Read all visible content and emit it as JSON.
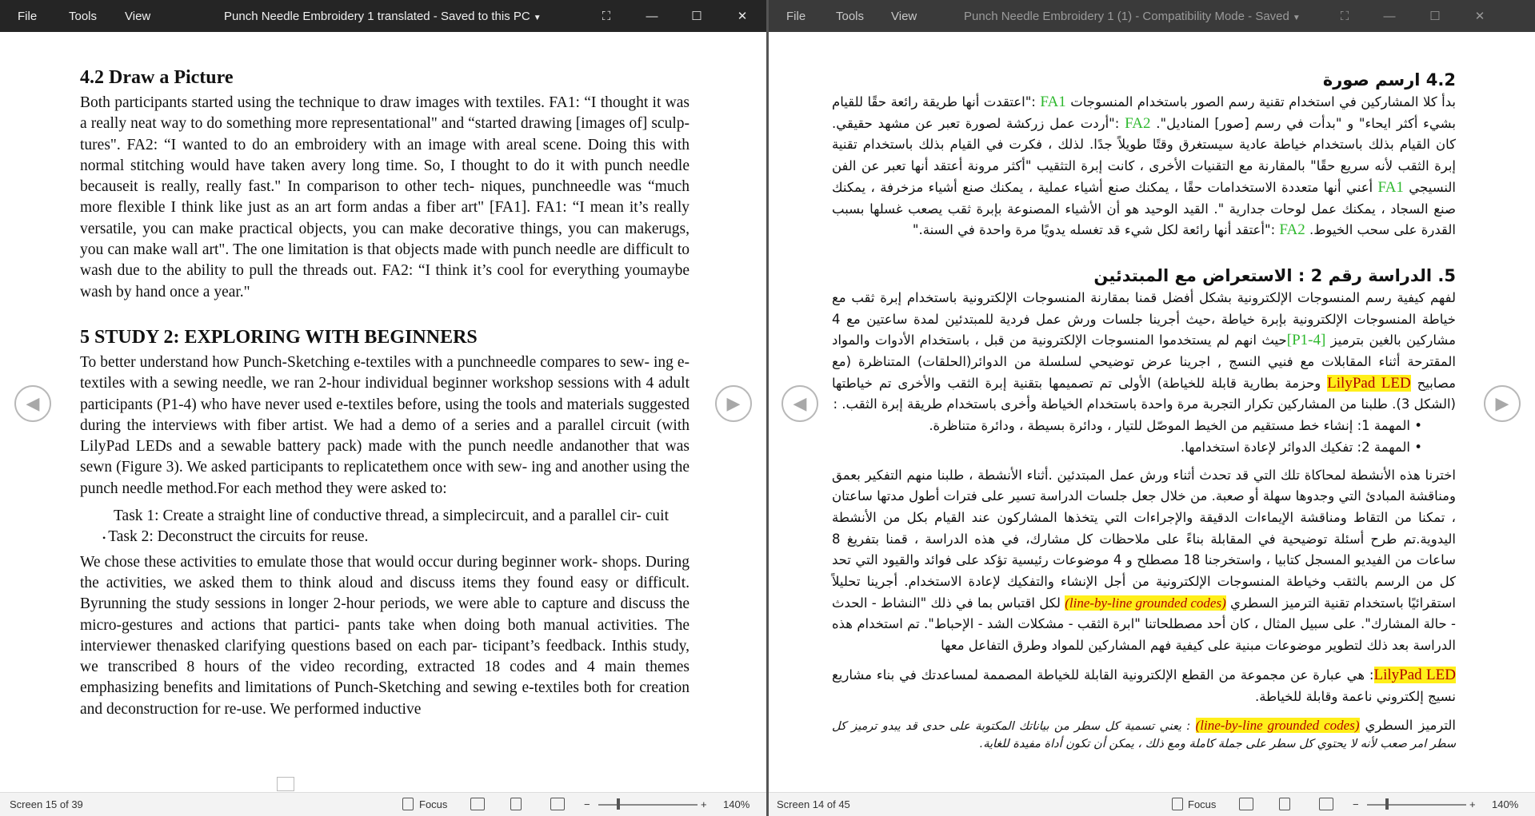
{
  "left": {
    "menu": {
      "file": "File",
      "tools": "Tools",
      "view": "View"
    },
    "title": "Punch Needle Embroidery 1 translated  -  Saved to this PC",
    "section42": "4.2 Draw a Picture",
    "p1": "Both participants started using the technique to draw images with textiles. FA1: “I thought it was a really neat way to do something more representational\" and “started drawing [images of] sculp- tures\". FA2: “I wanted to do an embroidery with an image with areal scene. Doing this with normal stitching would have taken avery long time. So, I thought to do it with punch needle becauseit is really, really fast.\" In comparison to other tech- niques, punchneedle was “much more flexible I think like just as an art form andas a fiber art\" [FA1]. FA1: “I mean it’s really versatile, you can make practical objects, you can make decorative things, you can makerugs, you can make wall art\". The one limitation is that objects made with punch needle are difficult to wash due to the ability to pull the threads out. FA2: “I think it’s cool for everything youmaybe wash by hand once a year.\"",
    "section5": "5 STUDY 2: EXPLORING WITH BEGINNERS",
    "p2": "To better understand how Punch-Sketching e-textiles with a punchneedle compares to sew- ing e-textiles with a sewing needle, we ran 2-hour individual beginner workshop sessions with 4 adult participants (P1-4) who have never used e-textiles before, using the tools and materials suggested during the interviews with fiber artist. We had a demo of a series and a parallel circuit (with LilyPad LEDs and a sewable battery pack) made with the punch needle andanother that was sewn (Figure 3). We asked participants to replicatethem once with sew- ing and another using the punch needle method.For each method they were asked to:",
    "task1": "Task 1: Create a straight line of conductive thread, a simplecircuit, and a parallel cir- cuit",
    "task2": "Task 2: Deconstruct the circuits for reuse.",
    "p3": "We chose these activities to emulate those that would occur during beginner work- shops. During the activities, we asked them to think aloud and discuss items they found easy or difficult. Byrunning the study sessions in longer 2-hour periods, we were able to capture and discuss the micro-gestures and actions that partici- pants take when doing both manual activities. The interviewer thenasked clarifying questions based on each par- ticipant’s feedback. Inthis study, we transcribed 8 hours of the video recording, extracted 18 codes and 4 main themes emphasizing benefits and limitations of Punch-Sketching and sewing e-textiles both for creation and deconstruction for re-use. We performed inductive",
    "status": {
      "screen": "Screen 15 of 39",
      "focus": "Focus",
      "zoom": "140%"
    }
  },
  "right": {
    "menu": {
      "file": "File",
      "tools": "Tools",
      "view": "View"
    },
    "title": "Punch Needle Embroidery 1 (1)  -  Compatibility Mode  -  Saved",
    "h42": "4.2  ارسم صورة",
    "p1a": "بدأ كلا المشاركين في استخدام تقنية رسم الصور باستخدام المنسوجات ",
    "fa1": "FA1",
    "p1b": " :\"اعتقدت أنها طريقة رائعة حقًا للقيام بشيء أكثر ايحاء\" و \"بدأت في رسم [صور] المناديل\". ",
    "fa2": "FA2",
    "p1c": " :\"أردت عمل زركشة لصورة تعبر عن مشهد حقيقي. كان القيام بذلك باستخدام خياطة عادية سيستغرق وقتًا طويلاً جدًا. لذلك ، فكرت في القيام بذلك باستخدام تقنية إبرة الثقب لأنه سريع حقًا\" بالمقارنة مع التقنيات الأخرى ، كانت إبرة التثقيب \"أكثر مرونة أعتقد أنها تعبر عن الفن النسيجي ",
    "p1d": " أعني أنها متعددة الاستخدامات حقًا ، يمكنك صنع أشياء عملية ، يمكنك صنع أشياء مزخرفة ، يمكنك صنع السجاد ، يمكنك عمل لوحات جدارية \". القيد الوحيد هو أن الأشياء المصنوعة بإبرة ثقب يصعب غسلها بسبب القدرة على سحب الخيوط. ",
    "p1e": " :\"أعتقد أنها رائعة لكل شيء قد تغسله يدويًا مرة واحدة في السنة.\"",
    "h5": "5. الدراسة رقم 2 : الاستعراض مع المبتدئين",
    "p2a": "لفهم كيفية رسم المنسوجات الإلكترونية بشكل أفضل قمنا بمقارنة المنسوجات الإلكترونية باستخدام إبرة ثقب مع خياطة المنسوجات الإلكترونية بإبرة خياطة ،حيث أجرينا جلسات ورش عمل فردية للمبتدئين لمدة ساعتين مع 4 مشاركين بالغين بترميز ",
    "p1_4": "[P1-4]",
    "p2b": "حيث انهم لم يستخدموا المنسوجات الإلكترونية من قبل ، باستخدام الأدوات والمواد المقترحة أثناء المقابلات مع فنيي النسج , اجرينا عرض توضيحي لسلسلة من الدوائر(الحلقات) المتناظرة (مع مصابيح ",
    "lilypad": "LilyPad LED",
    "p2c": " وحزمة بطارية قابلة للخياطة) الأولى تم تصميمها بتقنية إبرة الثقب والأخرى تم خياطتها (الشكل 3). طلبنا من المشاركين تكرار التجربة مرة واحدة باستخدام الخياطة وأخرى باستخدام طريقة إبرة الثقب. :",
    "task1": "المهمة 1: إنشاء خط مستقيم من الخيط الموصّل للتيار ، ودائرة بسيطة ، ودائرة متناظرة.",
    "task2": "المهمة 2: تفكيك الدوائر لإعادة استخدامها.",
    "p3a": "اخترنا هذه الأنشطة لمحاكاة تلك التي قد تحدث أثناء ورش عمل المبتدئين .أثناء الأنشطة ، طلبنا منهم التفكير بعمق ومناقشة المبادئ التي وجدوها سهلة أو صعبة. من خلال جعل جلسات الدراسة تسير على فترات أطول مدتها ساعتان ، تمكنا من التقاط ومناقشة الإيماءات الدقيقة والإجراءات التي يتخذها المشاركون عند القيام بكل من الأنشطة اليدوية.تم طرح أسئلة توضيحية في المقابلة بناءً على ملاحظات كل مشارك، في هذه الدراسة ، قمنا بتفريغ 8 ساعات من الفيديو المسجل كتابيا ، واستخرجنا 18 مصطلح و 4 موضوعات رئيسية تؤكد على فوائد والقيود التي تحد كل من الرسم بالثقب وخياطة المنسوجات الإلكترونية من أجل الإنشاء والتفكيك لإعادة الاستخدام. أجرينا تحليلاً استقرائيًا باستخدام تقنية الترميز السطري ",
    "codes": "(line-by-line grounded codes)",
    "p3b": " لكل اقتباس بما في ذلك \"النشاط - الحدث - حالة المشارك\". على سبيل المثال ، كان أحد مصطلحاتنا \"ابرة الثقب - مشكلات الشد - الإحباط\". تم استخدام هذه الدراسة بعد ذلك لتطوير موضوعات مبنية على كيفية فهم المشاركين للمواد وطرق التفاعل معها",
    "note1a": "LilyPad LED",
    "note1b": ": هي عبارة عن مجموعة من القطع الإلكترونية القابلة للخياطة المصممة لمساعدتك في بناء مشاريع نسيج إلكتروني ناعمة وقابلة للخياطة.",
    "note2a": "الترميز السطري ",
    "note2b": "(line-by-line grounded codes)",
    "note2c": " : يعني تسمية كل سطر من بياناتك المكتوبة على حدى قد يبدو ترميز كل سطر امر صعب لأنه لا يحتوي كل سطر على جملة كاملة ومع ذلك ، يمكن أن تكون أداة مفيدة للغاية.",
    "status": {
      "screen": "Screen 14 of 45",
      "focus": "Focus",
      "zoom": "140%"
    }
  },
  "icons": [
    "maximize-icon",
    "minimize-icon",
    "restore-icon",
    "close-icon",
    "prev-page-icon",
    "next-page-icon",
    "focus-icon",
    "read-mode-icon",
    "print-layout-icon",
    "web-layout-icon"
  ]
}
